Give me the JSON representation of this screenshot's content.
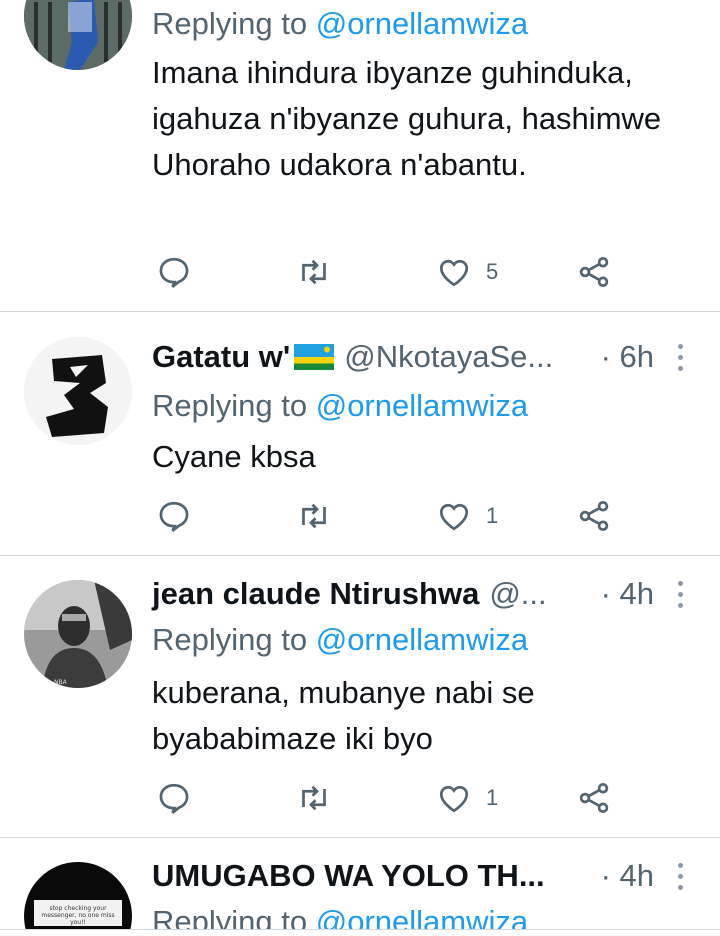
{
  "colors": {
    "accent": "#1d9bf0",
    "muted": "#536471",
    "divider": "#cfd9de"
  },
  "tweets": [
    {
      "name": "",
      "handle": "",
      "time": "",
      "replying_prefix": "Replying to",
      "replying_mention": "@ornellamwiza",
      "text": "Imana ihindura ibyanze guhinduka, igahuza n'ibyanze guhura, hashimwe Uhoraho udakora n'abantu.",
      "likes": "5"
    },
    {
      "name": "Gatatu w'",
      "flag": "🇷🇼",
      "handle": "@NkotayaSe...",
      "time": "· 6h",
      "replying_prefix": "Replying to",
      "replying_mention": "@ornellamwiza",
      "text": "Cyane kbsa",
      "likes": "1"
    },
    {
      "name": "jean claude Ntirushwa",
      "handle": "@...",
      "time": "· 4h",
      "replying_prefix": "Replying to",
      "replying_mention": "@ornellamwiza",
      "text": "kuberana, mubanye nabi se byababimaze iki byo",
      "likes": "1"
    },
    {
      "name": "UMUGABO WA YOLO TH...",
      "handle": "",
      "time": "· 4h",
      "replying_prefix": "Replying to",
      "replying_mention": "@ornellamwiza",
      "avatar_text": "stop checking your messenger, no one miss you!!"
    }
  ],
  "icons": [
    "reply-icon",
    "retweet-icon",
    "like-icon",
    "share-icon",
    "more-icon"
  ]
}
